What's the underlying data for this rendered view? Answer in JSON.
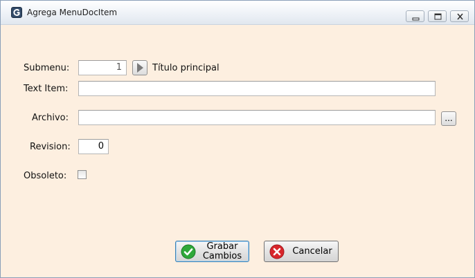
{
  "window": {
    "title": "Agrega MenuDocItem",
    "app_icon": "app-logo-icon",
    "controls": [
      "minimize-icon",
      "maximize-icon",
      "close-icon"
    ]
  },
  "form": {
    "submenu": {
      "label": "Submenu:",
      "value": "1",
      "arrow_icon": "play-arrow-icon",
      "caption": "Título principal"
    },
    "text_item": {
      "label": "Text Item:",
      "value": ""
    },
    "archivo": {
      "label": "Archivo:",
      "value": "",
      "browse_label": "..."
    },
    "revision": {
      "label": "Revision:",
      "value": "0"
    },
    "obsoleto": {
      "label": "Obsoleto:",
      "checked": false
    }
  },
  "buttons": {
    "save": {
      "line1": "Grabar",
      "line2": "Cambios",
      "icon": "checkmark-icon"
    },
    "cancel": {
      "label": "Cancelar",
      "icon": "cancel-x-icon"
    }
  },
  "colors": {
    "panel_bg": "#fdefe0",
    "save_icon": "#2fa83a",
    "cancel_icon": "#d8262b"
  }
}
